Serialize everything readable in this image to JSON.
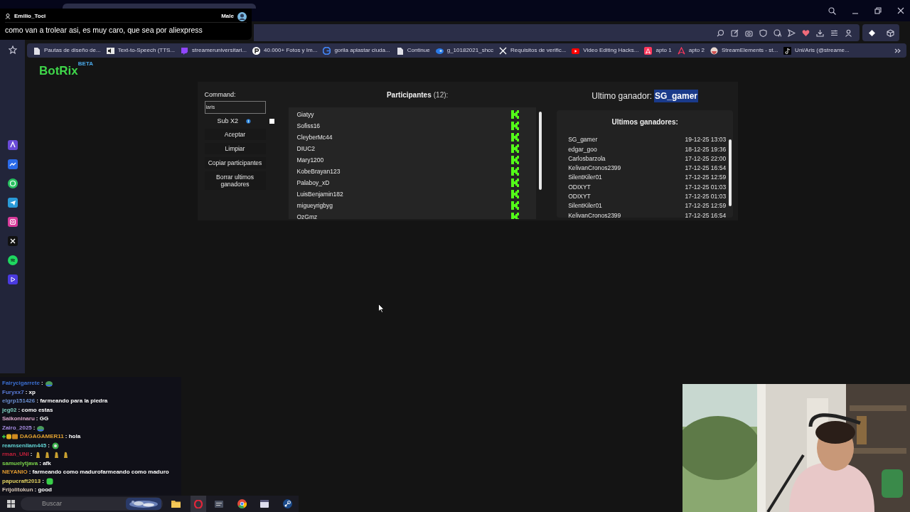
{
  "overlay_message": {
    "user": "Emilio_Toci",
    "gender": "Male",
    "text": "como van a trolear asi, es muy caro, que sea por aliexpress"
  },
  "bookmarks": [
    {
      "kind": "page",
      "title": "Pautas de diseño de..."
    },
    {
      "kind": "tts",
      "title": "Text-to-Speech (TTS..."
    },
    {
      "kind": "twitch",
      "title": "streameruniversitari..."
    },
    {
      "kind": "p",
      "title": "40.000+ Fotos y Im..."
    },
    {
      "kind": "google",
      "title": "gorila aplastar ciuda..."
    },
    {
      "kind": "page",
      "title": "Continue"
    },
    {
      "kind": "edge",
      "title": "g_10182021_shcc"
    },
    {
      "kind": "x",
      "title": "Requisitos de verific..."
    },
    {
      "kind": "youtube",
      "title": "Video Editing Hacks..."
    },
    {
      "kind": "airbnb",
      "title": "apto 1"
    },
    {
      "kind": "airbnb_outline",
      "title": "apto 2"
    },
    {
      "kind": "se",
      "title": "StreamElements - st..."
    },
    {
      "kind": "tiktok",
      "title": "Uni/Aris (@streame..."
    }
  ],
  "logo": {
    "name": "BotRix",
    "tag": "BETA"
  },
  "command": {
    "label": "Command:",
    "value": "laris"
  },
  "sub_x2": {
    "label": "Sub X2",
    "checked": false
  },
  "buttons": [
    "Aceptar",
    "Limpiar",
    "Copiar participantes",
    "Borrar ultimos ganadores"
  ],
  "participants": {
    "title": "Participantes",
    "count": "(12):",
    "names": [
      "Giatyy",
      "Sofiss16",
      "CleyberMc44",
      "DIUC2",
      "Mary1200",
      "KobeBrayan123",
      "Palaboy_xD",
      "LuisBenjamin182",
      "migueyrigbyg",
      "OzGmz"
    ]
  },
  "last_winner": {
    "label": "Ultimo ganador:",
    "name": "SG_gamer",
    "highlighted": true
  },
  "recent_winners": {
    "title": "Ultimos ganadores:",
    "rows": [
      {
        "name": "SG_gamer",
        "date": "19-12-25 13:03"
      },
      {
        "name": "edgar_goo",
        "date": "18-12-25 19:36"
      },
      {
        "name": "Carlosbarzola",
        "date": "17-12-25 22:00"
      },
      {
        "name": "KelivanCronos2399",
        "date": "17-12-25 16:54"
      },
      {
        "name": "SilentKiler01",
        "date": "17-12-25 12:59"
      },
      {
        "name": "ODIXYT",
        "date": "17-12-25 01:03"
      },
      {
        "name": "ODIXYT",
        "date": "17-12-25 01:03"
      },
      {
        "name": "SilentKiler01",
        "date": "17-12-25 12:59"
      },
      {
        "name": "KelivanCronos2399",
        "date": "17-12-25 16:54"
      }
    ]
  },
  "chat": [
    {
      "user": "Fairycigarrete",
      "color": "#3b6fd0",
      "text": ":",
      "emotes": [
        {
          "kind": "frog"
        }
      ]
    },
    {
      "user": "Furyxx7",
      "color": "#5a7bd8",
      "text": ": xp"
    },
    {
      "user": "elgrp151426",
      "color": "#6a8fd0",
      "text": ": farmeando para la piedra"
    },
    {
      "user": "jeg02",
      "color": "#7fd1c0",
      "text": ": como estas"
    },
    {
      "user": "Saikoninaru",
      "color": "#d9a6c9",
      "text": ": GG"
    },
    {
      "user": "Zairo_2025",
      "color": "#a58be0",
      "text": ":",
      "emotes": [
        {
          "kind": "frog"
        }
      ]
    },
    {
      "user": "DAGAGAMER11",
      "color": "#e0a030",
      "badges": true,
      "text": ": hola"
    },
    {
      "user": "reamsenllam445",
      "color": "#60d0d0",
      "text": ":",
      "emotes": [
        {
          "kind": "badge"
        }
      ]
    },
    {
      "user": "rman_UNI",
      "color": "#c0203a",
      "text": ":",
      "emotes": [
        {
          "kind": "figure"
        },
        {
          "kind": "figure"
        },
        {
          "kind": "figure"
        },
        {
          "kind": "figure"
        }
      ]
    },
    {
      "user": "samuelytjava",
      "color": "#7ad24a",
      "text": ": afk"
    },
    {
      "user": "NEYANIO",
      "color": "#e09a30",
      "text": ": farmeando como madurofarmeando como maduro"
    },
    {
      "user": "papucraft2013",
      "color": "#e0d060",
      "text": ":",
      "emotes": [
        {
          "kind": "green"
        }
      ]
    },
    {
      "user": "Frijolitokun",
      "color": "#d8c8b8",
      "text": ": good"
    }
  ],
  "taskbar": {
    "search_placeholder": "Buscar"
  }
}
